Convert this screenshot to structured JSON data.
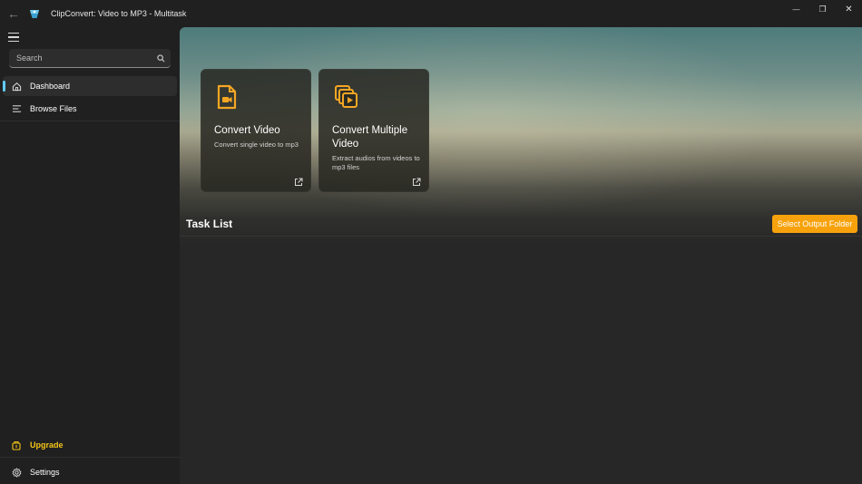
{
  "window": {
    "title": "ClipConvert: Video to MP3 - Multitask",
    "back_glyph": "←",
    "minimize_glyph": "—",
    "maximize_glyph": "❐",
    "close_glyph": "✕"
  },
  "sidebar": {
    "search_placeholder": "Search",
    "items": [
      {
        "label": "Dashboard",
        "icon": "home-icon",
        "active": true
      },
      {
        "label": "Browse Files",
        "icon": "list-icon",
        "active": false
      }
    ],
    "footer": [
      {
        "label": "Upgrade",
        "icon": "upgrade-icon"
      },
      {
        "label": "Settings",
        "icon": "gear-icon"
      }
    ]
  },
  "cards": [
    {
      "title": "Convert Video",
      "description": "Convert single video to mp3",
      "icon": "video-file-icon"
    },
    {
      "title": "Convert Multiple Video",
      "description": "Extract audios from videos to mp3 files",
      "icon": "multiple-video-icon"
    }
  ],
  "tasks": {
    "title": "Task List",
    "output_button": "Select Output Folder"
  },
  "colors": {
    "accent": "#f7a20c",
    "upgrade": "#f5c518",
    "nav_indicator": "#60cdff",
    "card_icon": "#f5a623"
  }
}
